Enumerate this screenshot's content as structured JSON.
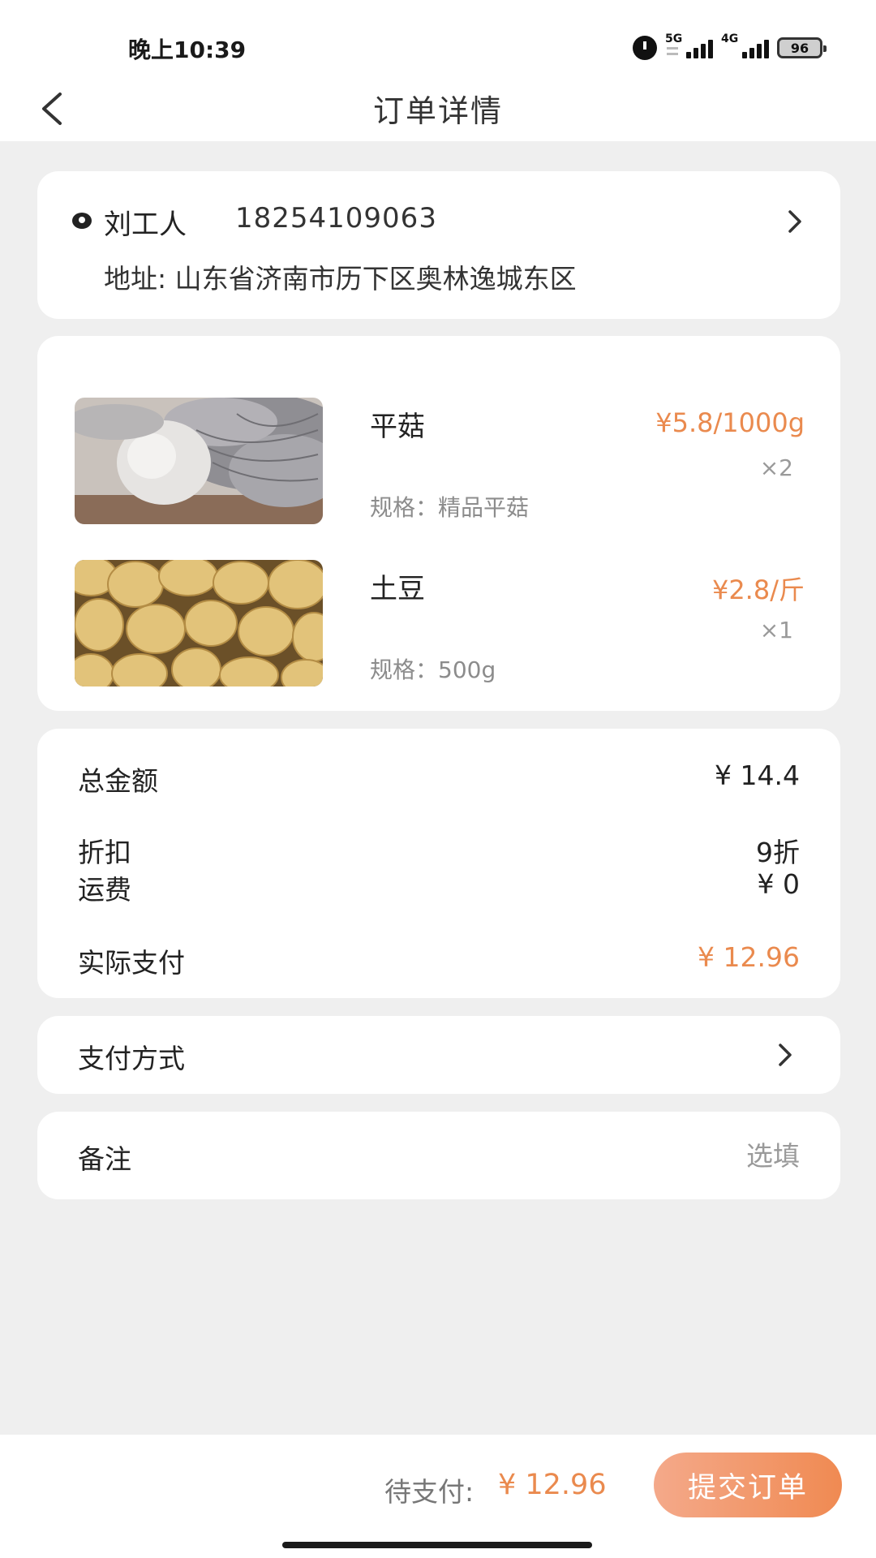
{
  "status_bar": {
    "time": "晚上10:39",
    "network_1": "5G",
    "network_2": "4G",
    "battery": "96"
  },
  "nav": {
    "title": "订单详情",
    "icons": {
      "back": "back-arrow-icon"
    }
  },
  "address": {
    "name": "刘工人",
    "phone": "18254109063",
    "line": "地址: 山东省济南市历下区奥林逸城东区",
    "icons": {
      "location": "location-pin-icon",
      "chevron": "chevron-right-icon"
    }
  },
  "products": [
    {
      "name": "平菇",
      "price": "¥5.8/1000g",
      "quantity": "×2",
      "spec": "规格：精品平菇",
      "image": "oyster-mushroom-photo"
    },
    {
      "name": "土豆",
      "price": "¥2.8/斤",
      "quantity": "×1",
      "spec": "规格：500g",
      "image": "potato-photo"
    }
  ],
  "totals": {
    "total_label": "总金额",
    "total_value": "¥ 14.4",
    "discount_label": "折扣",
    "discount_value": "9折",
    "shipping_label": "运费",
    "shipping_value": "¥ 0",
    "paid_label": "实际支付",
    "paid_value": "¥ 12.96"
  },
  "payment": {
    "label": "支付方式"
  },
  "note": {
    "label": "备注",
    "placeholder": "选填"
  },
  "bottom": {
    "pending_label": "待支付:",
    "pending_amount": "¥ 12.96",
    "submit_label": "提交订单"
  },
  "colors": {
    "accent": "#ea8a4e",
    "button_gradient_start": "#f4a98a",
    "button_gradient_end": "#f08a52",
    "background": "#efefef"
  }
}
